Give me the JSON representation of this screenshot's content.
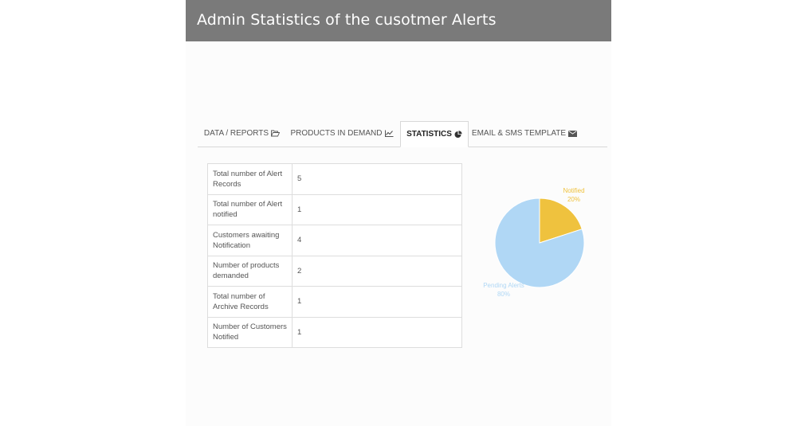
{
  "header": {
    "title": "Admin Statistics of the cusotmer Alerts"
  },
  "tabs": [
    {
      "label": "DATA / REPORTS",
      "icon": "folder-open-icon"
    },
    {
      "label": "PRODUCTS IN DEMAND",
      "icon": "line-chart-icon"
    },
    {
      "label": "STATISTICS",
      "icon": "pie-chart-icon",
      "active": true
    },
    {
      "label": "EMAIL & SMS TEMPLATE",
      "icon": "envelope-icon"
    }
  ],
  "stats": [
    {
      "label": "Total number of Alert Records",
      "value": "5"
    },
    {
      "label": "Total number of Alert notified",
      "value": "1"
    },
    {
      "label": "Customers awaiting Notification",
      "value": "4"
    },
    {
      "label": "Number of products demanded",
      "value": "2"
    },
    {
      "label": "Total number of Archive Records",
      "value": "1"
    },
    {
      "label": "Number of Customers Notified",
      "value": "1"
    }
  ],
  "chart_data": {
    "type": "pie",
    "slices": [
      {
        "label": "Notified",
        "percent_label": "20%",
        "value": 20,
        "color": "#efc23e"
      },
      {
        "label": "Pending Alerts",
        "percent_label": "80%",
        "value": 80,
        "color": "#b0d7f5"
      }
    ]
  }
}
